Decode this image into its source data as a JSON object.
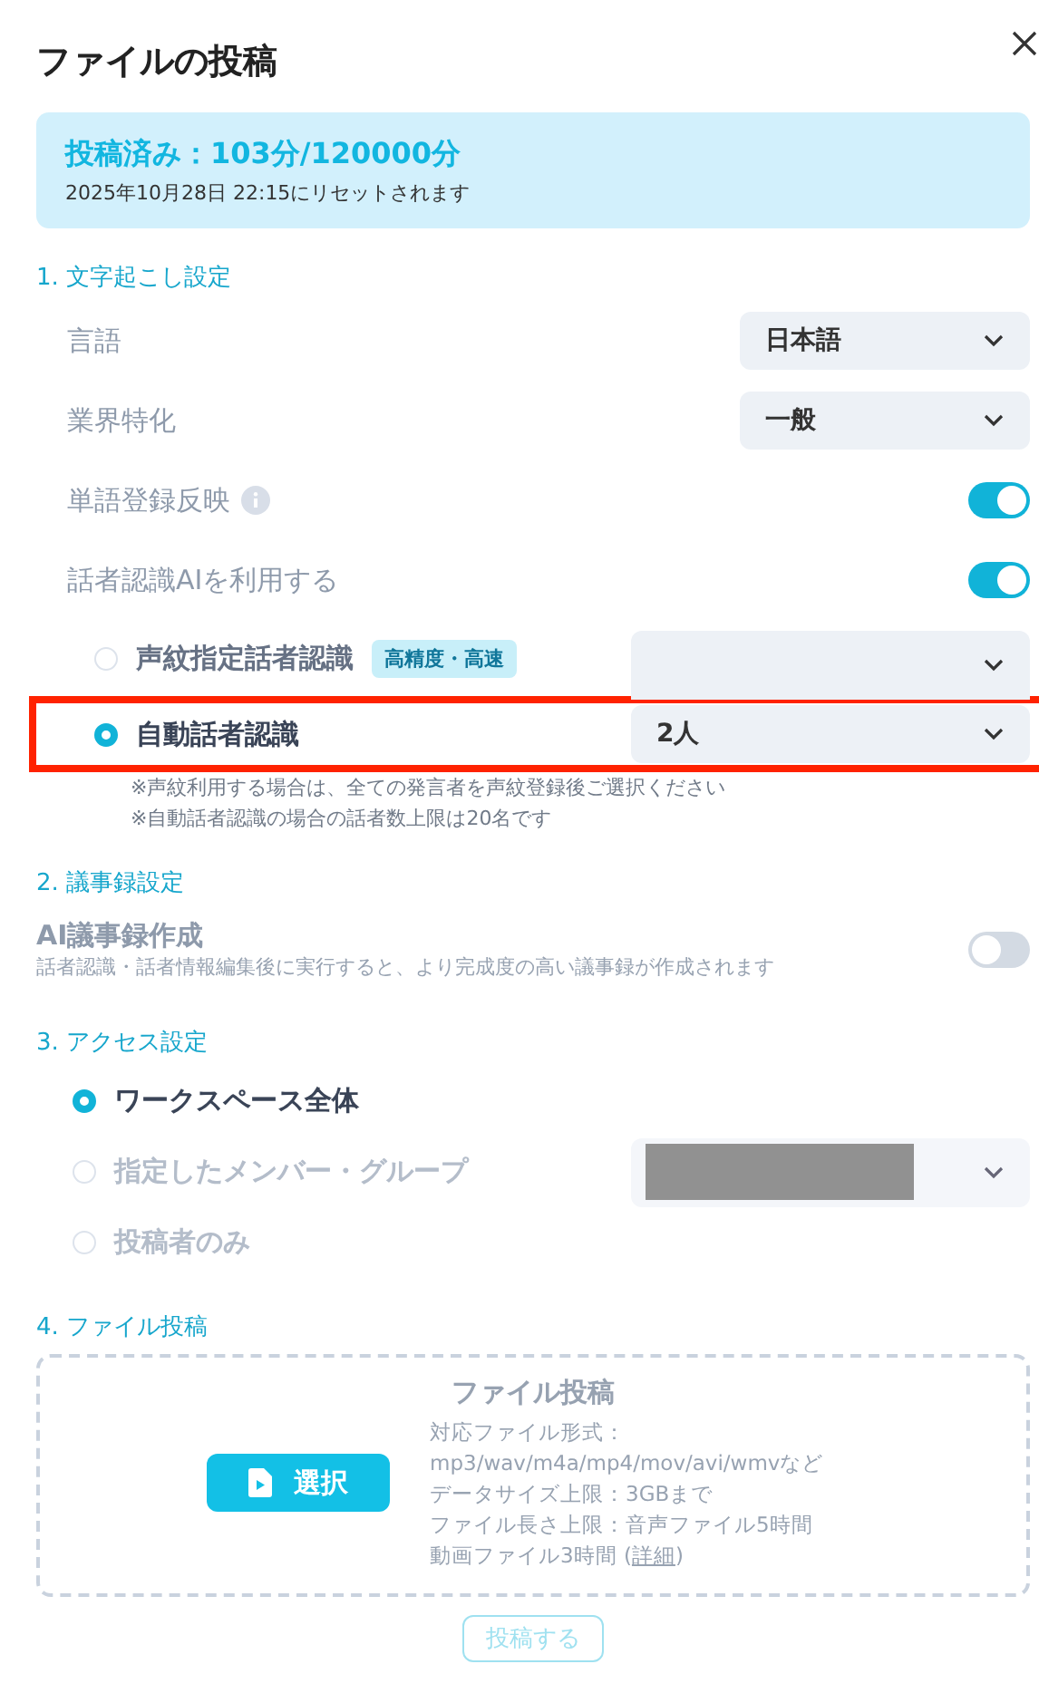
{
  "title": "ファイルの投稿",
  "quota": {
    "title": "投稿済み：103分/120000分",
    "subtitle": "2025年10月28日 22:15にリセットされます"
  },
  "sections": [
    {
      "heading": "1. 文字起こし設定",
      "items": [
        {
          "kind": "select",
          "label": "言語",
          "value": "日本語"
        },
        {
          "kind": "select",
          "label": "業界特化",
          "value": "一般"
        },
        {
          "kind": "toggle",
          "label": "単語登録反映",
          "info": true,
          "on": true
        },
        {
          "kind": "toggle",
          "label": "話者認識AIを利用する",
          "info": false,
          "on": true
        },
        {
          "kind": "radio",
          "label": "声紋指定話者認識",
          "badge": "高精度・高速",
          "selected": false,
          "disabled": false,
          "dropdown": true,
          "highlighted": false
        },
        {
          "kind": "radio",
          "label": "自動話者認識",
          "selected": true,
          "disabled": false,
          "dropdown": true,
          "dropdown_value": "2人",
          "highlighted": true
        },
        {
          "kind": "note",
          "text": "※声紋利用する場合は、全ての発言者を声紋登録後ご選択ください"
        },
        {
          "kind": "note",
          "text": "※自動話者認識の場合の話者数上限は20名です"
        }
      ]
    },
    {
      "heading": "2. 議事録設定",
      "items": [
        {
          "kind": "toggle_desc",
          "label": "AI議事録作成",
          "description": "話者認識・話者情報編集後に実行すると、より完成度の高い議事録が作成されます",
          "on": false
        }
      ]
    },
    {
      "heading": "3. アクセス設定",
      "items": [
        {
          "kind": "radio",
          "label": "ワークスペース全体",
          "selected": true,
          "disabled": false,
          "dropdown": false,
          "highlighted": false
        },
        {
          "kind": "radio",
          "label": "指定したメンバー・グループ",
          "selected": false,
          "disabled": true,
          "dropdown": true,
          "redacted": true,
          "highlighted": false
        },
        {
          "kind": "radio",
          "label": "投稿者のみ",
          "selected": false,
          "disabled": true,
          "dropdown": false,
          "highlighted": false
        }
      ]
    },
    {
      "heading": "4. ファイル投稿",
      "items": [
        {
          "kind": "upload",
          "title": "ファイル投稿",
          "button": "選択",
          "lines": [
            "対応ファイル形式：",
            "mp3/wav/m4a/mp4/mov/avi/wmvなど",
            "データサイズ上限：3GBまで",
            "ファイル長さ上限：音声ファイル5時間"
          ],
          "last_line": {
            "before": "動画ファイル3時間 (",
            "link": "詳細",
            "after": ")"
          }
        }
      ]
    }
  ],
  "submit": {
    "label": "投稿する",
    "disabled": true
  }
}
